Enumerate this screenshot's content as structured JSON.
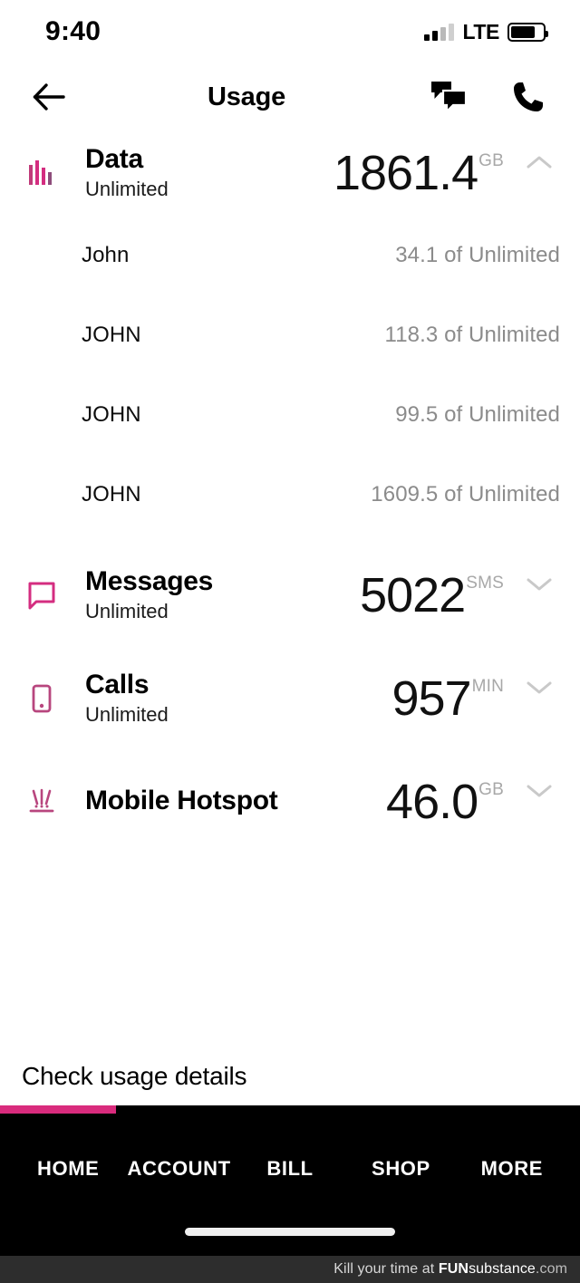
{
  "status_bar": {
    "time": "9:40",
    "network": "LTE",
    "signal_bars_filled": 2,
    "signal_bars_total": 4,
    "battery_percent": 76
  },
  "header": {
    "title": "Usage",
    "back_icon": "arrow-left-icon",
    "messages_icon": "chat-bubbles-icon",
    "call_icon": "phone-handset-icon"
  },
  "sections": [
    {
      "icon": "bar-chart-icon",
      "title": "Data",
      "subtitle": "Unlimited",
      "value": "1861.4",
      "unit": "GB",
      "expanded": true,
      "chevron": "chevron-up-icon",
      "lines": [
        {
          "name": "John",
          "value": "34.1 of Unlimited"
        },
        {
          "name": "JOHN",
          "value": "118.3 of Unlimited"
        },
        {
          "name": "JOHN",
          "value": "99.5 of Unlimited"
        },
        {
          "name": "JOHN",
          "value": "1609.5 of Unlimited"
        }
      ]
    },
    {
      "icon": "speech-bubble-icon",
      "title": "Messages",
      "subtitle": "Unlimited",
      "value": "5022",
      "unit": "SMS",
      "expanded": false,
      "chevron": "chevron-down-icon",
      "lines": []
    },
    {
      "icon": "phone-device-icon",
      "title": "Calls",
      "subtitle": "Unlimited",
      "value": "957",
      "unit": "MIN",
      "expanded": false,
      "chevron": "chevron-down-icon",
      "lines": []
    },
    {
      "icon": "hotspot-rays-icon",
      "title": "Mobile Hotspot",
      "subtitle": "",
      "value": "46.0",
      "unit": "GB",
      "expanded": false,
      "chevron": "chevron-down-icon",
      "lines": []
    }
  ],
  "details_link": "Check usage details",
  "bottom_nav": {
    "active_index": 0,
    "tabs": [
      {
        "label": "HOME"
      },
      {
        "label": "ACCOUNT"
      },
      {
        "label": "BILL"
      },
      {
        "label": "SHOP"
      },
      {
        "label": "MORE"
      }
    ]
  },
  "watermark": {
    "prefix": "Kill your time at ",
    "brand_bold": "FUN",
    "brand_rest": "substance",
    "suffix": ".com"
  },
  "colors": {
    "magenta": "#d92b7d",
    "icon_magenta": "#c03b7a",
    "muted_grey": "#8b8b8b",
    "unit_grey": "#a8a8a8",
    "black": "#000000"
  }
}
